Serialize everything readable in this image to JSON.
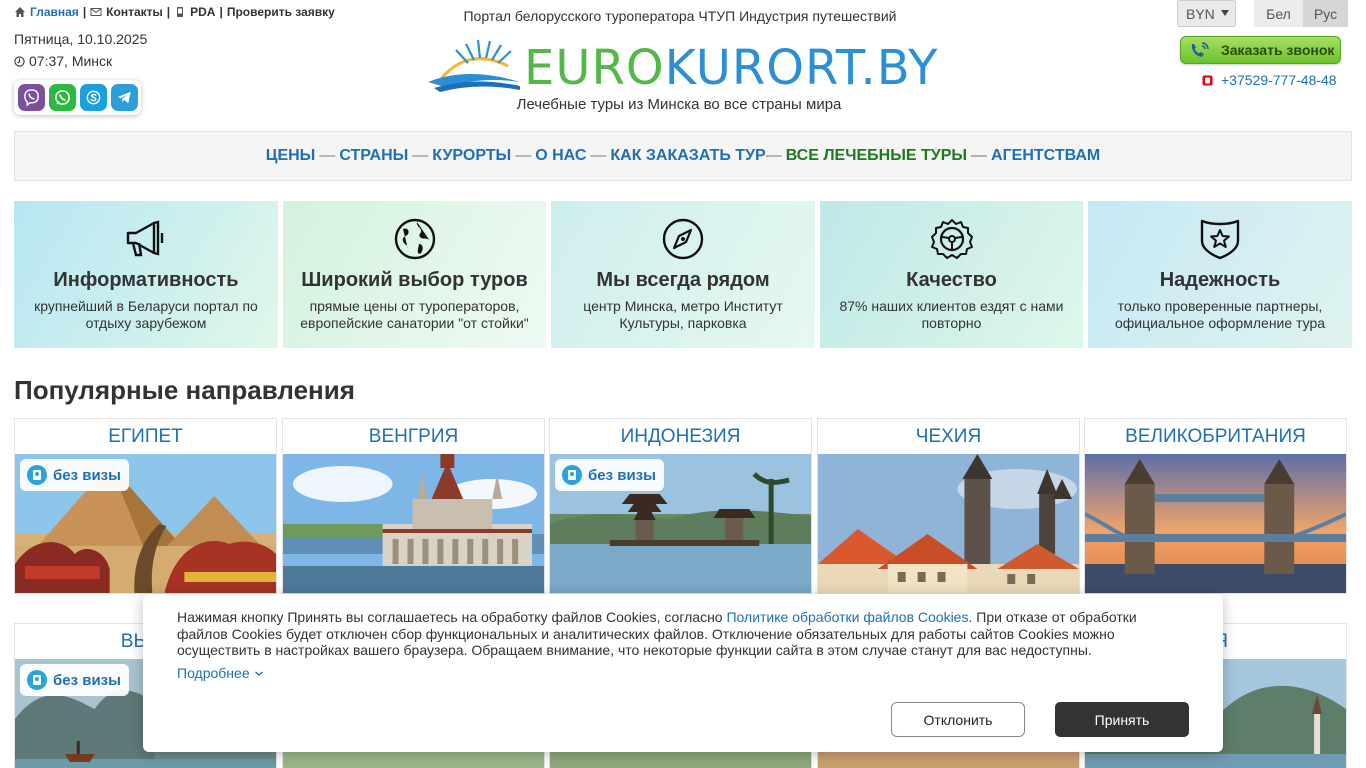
{
  "header": {
    "nav": {
      "home": "Главная",
      "contacts": "Контакты",
      "pda": "PDA",
      "check_request": "Проверить заявку",
      "separator": "|"
    },
    "date": "Пятница, 10.10.2025",
    "time": "07:37, Минск",
    "messengers": [
      "viber-icon",
      "whatsapp-icon",
      "skype-icon",
      "telegram-icon"
    ],
    "portal_title": "Портал белорусского туроператора ЧТУП Индустрия путешествий",
    "logo_text": "EUROKURORT.BY",
    "slogan": "Лечебные туры из Минска во все страны мира",
    "currency": "BYN",
    "languages": [
      "Бел",
      "Рус"
    ],
    "callback_label": "Заказать звонок",
    "phone": "+37529-777-48-48"
  },
  "main_nav": {
    "items": [
      "ЦЕНЫ",
      "СТРАНЫ",
      "КУРОРТЫ",
      "О НАС",
      "КАК ЗАКАЗАТЬ ТУР",
      "ВСЕ ЛЕЧЕБНЫЕ ТУРЫ",
      "АГЕНТСТВАМ"
    ],
    "separator": "—"
  },
  "features": [
    {
      "icon": "megaphone-icon",
      "title": "Информативность",
      "text": "крупнейший в Беларуси портал по отдыху зарубежом"
    },
    {
      "icon": "globe-icon",
      "title": "Широкий выбор туров",
      "text": "прямые цены от туроператоров, европейские санатории \"от стойки\""
    },
    {
      "icon": "compass-icon",
      "title": "Мы всегда рядом",
      "text": "центр Минска, метро Институт Культуры, парковка"
    },
    {
      "icon": "steering-wheel-icon",
      "title": "Качество",
      "text": "87% наших клиентов ездят с нами повторно"
    },
    {
      "icon": "shield-star-icon",
      "title": "Надежность",
      "text": "только проверенные партнеры, официальное оформление тура"
    }
  ],
  "popular": {
    "title": "Популярные направления",
    "visa_badge": "без визы",
    "row1": [
      "ЕГИПЕТ",
      "ВЕНГРИЯ",
      "ИНДОНЕЗИЯ",
      "ЧЕХИЯ",
      "ВЕЛИКОБРИТАНИЯ"
    ],
    "row2_visible": [
      "ВЬЕТ",
      "РИЯ"
    ]
  },
  "cookie": {
    "text_before": "Нажимая кнопку Принять вы соглашаетесь на обработку файлов Cookies, согласно ",
    "policy_link": "Политике обработки файлов Cookies",
    "text_after": ". При отказе от обработки файлов Cookies будет отключен сбор функциональных и аналитических файлов. Отключение обязательных для работы сайтов Cookies можно осуществить в настройках вашего браузера. Обращаем внимание, что некоторые функции сайта в этом случае станут для вас недоступны.",
    "more": "Подробнее",
    "decline": "Отклонить",
    "accept": "Принять"
  },
  "colors": {
    "link_blue": "#1f6fb5",
    "nav_green": "#1e7a1e",
    "callback_green": "#6cc02c",
    "accept_button": "#333333"
  }
}
